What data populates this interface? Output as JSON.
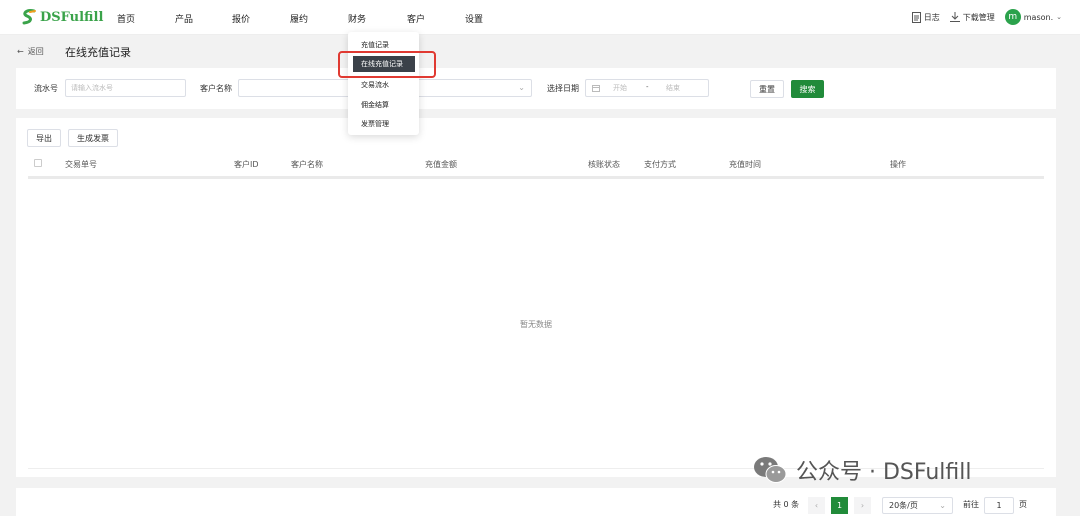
{
  "brand": {
    "name": "DSFulfill"
  },
  "nav": [
    "首页",
    "产品",
    "报价",
    "履约",
    "财务",
    "客户",
    "设置"
  ],
  "tools": {
    "log": "日志",
    "download": "下载管理",
    "user": "mason.",
    "avatar_letter": "m"
  },
  "breadcrumb": {
    "back": "返回",
    "title": "在线充值记录"
  },
  "filters": {
    "serial_label": "流水号",
    "serial_placeholder": "请输入流水号",
    "customer_label": "客户名称",
    "date_label": "选择日期",
    "date_start": "开始",
    "date_sep": "-",
    "date_end": "结束",
    "reset": "重置",
    "search": "搜索"
  },
  "actions": {
    "export": "导出",
    "invoice": "生成发票"
  },
  "table": {
    "columns": [
      "交易单号",
      "客户ID",
      "客户名称",
      "充值金额",
      "核账状态",
      "支付方式",
      "充值时间",
      "操作"
    ],
    "empty": "暂无数据"
  },
  "pager": {
    "total": "共 0 条",
    "page": "1",
    "size": "20条/页",
    "goto": "前往",
    "goto_value": "1",
    "unit": "页"
  },
  "dropdown": {
    "items": [
      "充值记录",
      "在线充值记录",
      "交易流水",
      "佣金结算",
      "发票管理"
    ],
    "active": "在线充值记录"
  },
  "watermark": {
    "text": "公众号 · DSFulfill"
  },
  "colors": {
    "brand_green": "#218b3a",
    "highlight": "#e03a32",
    "dark_menu": "#3b4149"
  }
}
